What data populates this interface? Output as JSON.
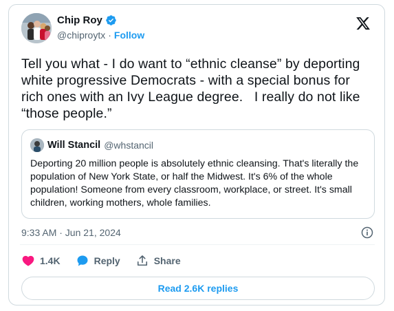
{
  "author": {
    "name": "Chip Roy",
    "handle": "@chiproytx",
    "separator": "·",
    "follow_label": "Follow"
  },
  "tweet": {
    "text": "Tell you what - I do want to “ethnic cleanse” by deporting white progressive Democrats - with a special bonus for rich ones with an Ivy League degree.   I really do not like “those people.”"
  },
  "quoted_tweet": {
    "name": "Will Stancil",
    "handle": "@whstancil",
    "text": "Deporting 20 million people is absolutely ethnic cleansing. That's literally the population of New York State, or half the Midwest. It's 6% of the whole population! Someone from every classroom, workplace, or street. It's small children, working mothers, whole families."
  },
  "timestamp": "9:33 AM · Jun 21, 2024",
  "actions": {
    "likes": "1.4K",
    "reply_label": "Reply",
    "share_label": "Share"
  },
  "read_replies_label": "Read 2.6K replies",
  "colors": {
    "accent": "#1d9bf0",
    "like": "#f91880",
    "secondary_text": "#536471",
    "border": "#cfd9de"
  },
  "icons": [
    "verified-badge-icon",
    "x-logo-icon",
    "info-icon",
    "heart-icon",
    "reply-bubble-icon",
    "share-icon"
  ]
}
